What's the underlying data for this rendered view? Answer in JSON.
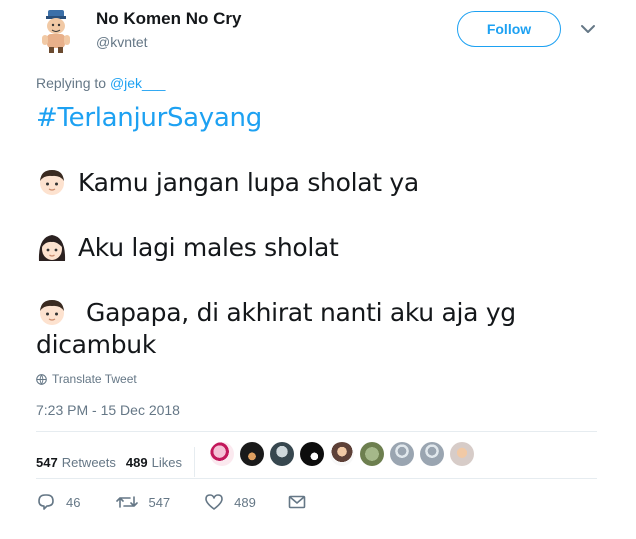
{
  "user": {
    "name": "No Komen No Cry",
    "handle": "@kvntet",
    "follow_label": "Follow"
  },
  "reply": {
    "prefix": "Replying to",
    "mention": "@jek___"
  },
  "tweet": {
    "hashtag": "#TerlanjurSayang",
    "line1": "Kamu jangan lupa sholat ya",
    "line2": "Aku lagi males sholat",
    "line3a": "Gapapa, di akhirat nanti aku aja yg",
    "line3b": "dicambuk",
    "line1_emoji": "boy-emoji",
    "line2_emoji": "woman-emoji",
    "line3_emoji": "boy-emoji"
  },
  "translate_label": "Translate Tweet",
  "timestamp": "7:23 PM - 15 Dec 2018",
  "stats": {
    "retweets_count": "547",
    "retweets_label": "Retweets",
    "likes_count": "489",
    "likes_label": "Likes"
  },
  "actions": {
    "reply_count": "46",
    "retweet_count": "547",
    "like_count": "489"
  },
  "colors": {
    "accent": "#1da1f2",
    "text": "#14171a",
    "muted": "#657786",
    "divider": "#e6ecf0"
  }
}
